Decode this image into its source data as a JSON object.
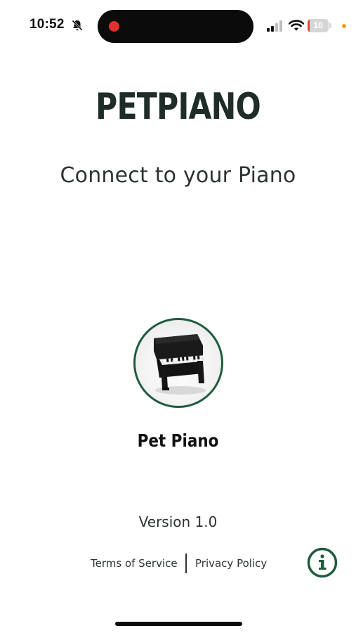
{
  "status_bar": {
    "time": "10:52",
    "battery_percent": 10,
    "battery_label": "10",
    "icons": [
      "bell-off-icon",
      "signal-icon",
      "wifi-icon",
      "battery-icon"
    ],
    "recording_color": "#e0312b",
    "battery_color": "#e0443a",
    "privacy_dot_color": "#f29b1d"
  },
  "header": {
    "app_title": "PETPIANO",
    "subtitle": "Connect to your Piano"
  },
  "device": {
    "name": "Pet Piano",
    "ring_color": "#1f5b3e"
  },
  "footer": {
    "version": "Version 1.0",
    "terms_label": "Terms of Service",
    "privacy_label": "Privacy Policy",
    "info_icon": "info-icon",
    "accent_color": "#1f5b3e"
  }
}
